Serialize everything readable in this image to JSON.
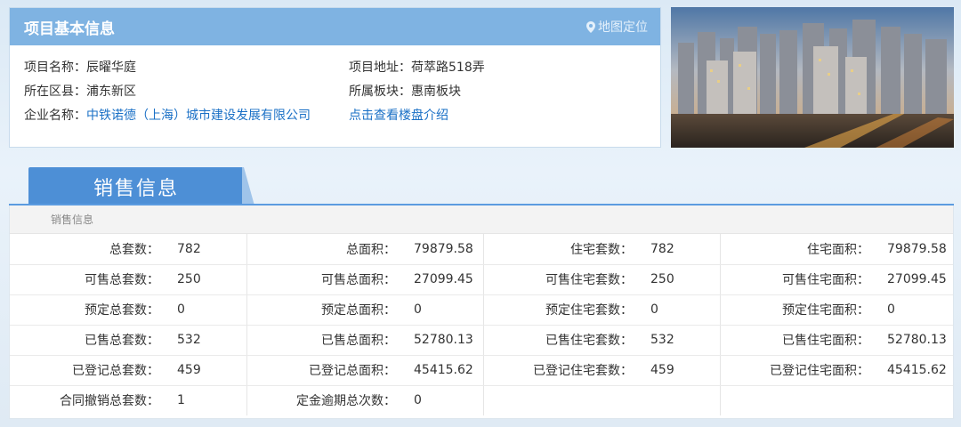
{
  "project_info": {
    "title": "项目基本信息",
    "map_link": "地图定位",
    "fields": [
      {
        "label": "项目名称：",
        "value": "辰曜华庭"
      },
      {
        "label": "所在区县：",
        "value": "浦东新区"
      },
      {
        "label": "企业名称：",
        "value": "中铁诺德（上海）城市建设发展有限公司"
      },
      {
        "label": "项目地址：",
        "value": "荷萃路518弄"
      },
      {
        "label": "所属板块：",
        "value": "惠南板块"
      }
    ],
    "intro_link": "点击查看楼盘介绍"
  },
  "sales": {
    "tab_label": "销售信息",
    "subheader": "销售信息",
    "rows": [
      [
        {
          "k": "总套数：",
          "v": "782"
        },
        {
          "k": "总面积：",
          "v": "79879.58"
        },
        {
          "k": "住宅套数：",
          "v": "782"
        },
        {
          "k": "住宅面积：",
          "v": "79879.58"
        }
      ],
      [
        {
          "k": "可售总套数：",
          "v": "250"
        },
        {
          "k": "可售总面积：",
          "v": "27099.45"
        },
        {
          "k": "可售住宅套数：",
          "v": "250"
        },
        {
          "k": "可售住宅面积：",
          "v": "27099.45"
        }
      ],
      [
        {
          "k": "预定总套数：",
          "v": "0"
        },
        {
          "k": "预定总面积：",
          "v": "0"
        },
        {
          "k": "预定住宅套数：",
          "v": "0"
        },
        {
          "k": "预定住宅面积：",
          "v": "0"
        }
      ],
      [
        {
          "k": "已售总套数：",
          "v": "532"
        },
        {
          "k": "已售总面积：",
          "v": "52780.13"
        },
        {
          "k": "已售住宅套数：",
          "v": "532"
        },
        {
          "k": "已售住宅面积：",
          "v": "52780.13"
        }
      ],
      [
        {
          "k": "已登记总套数：",
          "v": "459"
        },
        {
          "k": "已登记总面积：",
          "v": "45415.62"
        },
        {
          "k": "已登记住宅套数：",
          "v": "459"
        },
        {
          "k": "已登记住宅面积：",
          "v": "45415.62"
        }
      ],
      [
        {
          "k": "合同撤销总套数：",
          "v": "1"
        },
        {
          "k": "定金逾期总次数：",
          "v": "0"
        },
        {
          "k": "",
          "v": ""
        },
        {
          "k": "",
          "v": ""
        }
      ]
    ]
  },
  "colors": {
    "header_blue": "#7fb3e2",
    "tab_blue": "#4d8fd6",
    "link_blue": "#1a70c6"
  }
}
